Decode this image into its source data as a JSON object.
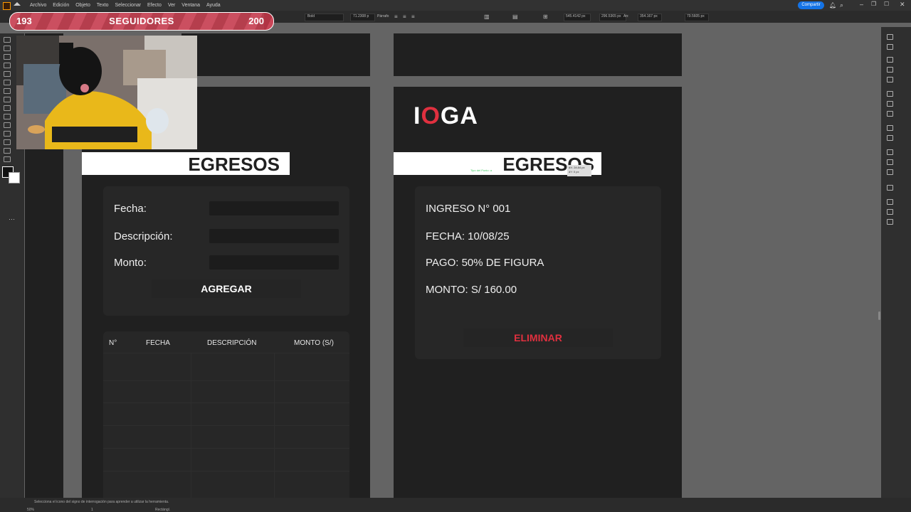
{
  "menubar": {
    "app_icon": "ai-logo-icon",
    "items": [
      "Archivo",
      "Edición",
      "Objeto",
      "Texto",
      "Seleccionar",
      "Efecto",
      "Ver",
      "Ventana",
      "Ayuda"
    ],
    "share_label": "Compartir"
  },
  "control_bar": {
    "font_weight": "Bold",
    "font_size": "71.2308 p",
    "paragraph_label": "Párrafo",
    "x_value": "545.4142 px",
    "y_value": "296.5365 px",
    "w_label": "An:",
    "w_value": "354.167 px",
    "h_value": "79.5605 px"
  },
  "followers": {
    "current": "193",
    "label": "SEGUIDORES",
    "goal": "200",
    "progress_fraction": 0.965
  },
  "artboard_left": {
    "header": "EGRESOS",
    "form": {
      "fecha_label": "Fecha:",
      "descripcion_label": "Descripción:",
      "monto_label": "Monto:",
      "add_button": "AGREGAR"
    },
    "table": {
      "headers": [
        "N°",
        "FECHA",
        "DESCRIPCIÓN",
        "MONTO (S/)"
      ]
    }
  },
  "artboard_right": {
    "logo": {
      "before": "I",
      "o": "O",
      "after": "GA"
    },
    "header": "EGRESOS",
    "tooltip": {
      "dx": "dX: 28.84 px",
      "dy": "dY: 0 px"
    },
    "smart_guide": "Tipo del Punto: a",
    "details": {
      "ingreso": "INGRESO N° 001",
      "fecha": "FECHA: 10/08/25",
      "pago": "PAGO: 50% DE FIGURA",
      "monto": "MONTO: S/ 160.00"
    },
    "delete_button": "ELIMINAR"
  },
  "colors": {
    "accent_red": "#e0303f",
    "artboard_bg": "#202020",
    "share_blue": "#1473e6"
  },
  "statusbar": {
    "zoom": "50%",
    "page": "1",
    "mode": "Rectángl.",
    "hint": "Selecciona el icono del signo de interrogación para aprender a utilizar la herramienta."
  }
}
